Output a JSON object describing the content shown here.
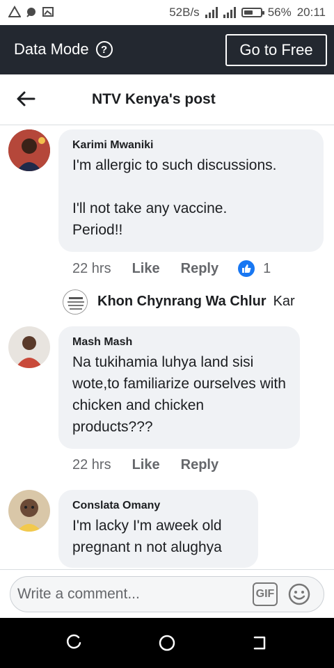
{
  "status_bar": {
    "speed": "52B/s",
    "battery_percent": "56%",
    "battery_level": 0.56,
    "time": "20:11"
  },
  "data_bar": {
    "label": "Data Mode",
    "help_icon": "question-mark-circle-icon",
    "button_label": "Go to Free"
  },
  "header": {
    "back_icon": "arrow-left-icon",
    "title": "NTV Kenya's post"
  },
  "comments": [
    {
      "author": "Karimi Mwaniki",
      "text": "I'm allergic to such discussions.\n\nI'll not take any vaccine.\nPeriod!!",
      "time": "22 hrs",
      "like_label": "Like",
      "reply_label": "Reply",
      "reaction_count": "1"
    },
    {
      "author": "Mash Mash",
      "text": "Na tukihamia luhya land sisi wote,to familiarize ourselves with chicken and chicken products???",
      "time": "22 hrs",
      "like_label": "Like",
      "reply_label": "Reply"
    },
    {
      "author": "Conslata Omany",
      "text": "I'm lacky I'm aweek old pregnant n not alughya"
    }
  ],
  "reply_preview": {
    "author": "Khon Chynrang Wa Chlur",
    "snippet": "Kar"
  },
  "composer": {
    "placeholder": "Write a comment...",
    "gif_label": "GIF",
    "emoji_icon": "smiley-icon"
  },
  "colors": {
    "data_bar": "#232830",
    "bubble": "#f0f2f5",
    "like_blue": "#1877f2",
    "nav": "#000000"
  }
}
